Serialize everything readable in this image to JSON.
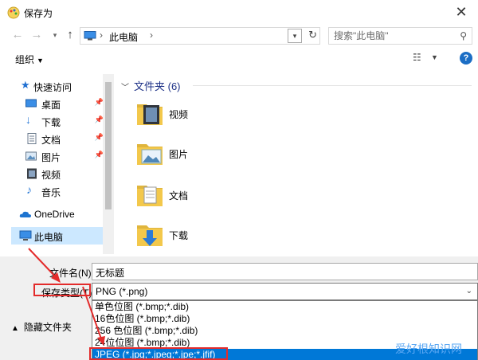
{
  "window": {
    "title": "保存为"
  },
  "address": {
    "crumb": "此电脑"
  },
  "search": {
    "placeholder": "搜索\"此电脑\""
  },
  "toolbar": {
    "organize": "组织"
  },
  "nav": {
    "items": [
      {
        "label": "快速访问",
        "icon": "star-icon",
        "pinned": false
      },
      {
        "label": "桌面",
        "icon": "desktop-icon",
        "pinned": true
      },
      {
        "label": "下载",
        "icon": "download-icon",
        "pinned": true
      },
      {
        "label": "文档",
        "icon": "document-icon",
        "pinned": true
      },
      {
        "label": "图片",
        "icon": "picture-icon",
        "pinned": true
      },
      {
        "label": "视频",
        "icon": "video-icon",
        "pinned": false
      },
      {
        "label": "音乐",
        "icon": "music-icon",
        "pinned": false
      },
      {
        "label": "OneDrive",
        "icon": "cloud-icon",
        "pinned": false
      },
      {
        "label": "此电脑",
        "icon": "computer-icon",
        "pinned": false,
        "selected": true
      }
    ]
  },
  "content": {
    "group_header": "文件夹 (6)",
    "folders": [
      {
        "name": "视频",
        "icon": "video-folder-icon"
      },
      {
        "name": "图片",
        "icon": "pictures-folder-icon"
      },
      {
        "name": "文档",
        "icon": "documents-folder-icon"
      },
      {
        "name": "下载",
        "icon": "downloads-folder-icon"
      }
    ]
  },
  "form": {
    "filename_label": "文件名(N):",
    "filename_value": "无标题",
    "filetype_label": "保存类型(T):",
    "filetype_value": "PNG (*.png)",
    "options": [
      "单色位图 (*.bmp;*.dib)",
      "16色位图 (*.bmp;*.dib)",
      "256 色位图 (*.bmp;*.dib)",
      "24位位图 (*.bmp;*.dib)",
      "JPEG (*.jpg;*.jpeg;*.jpe;*.jfif)"
    ],
    "highlighted_option": 4,
    "hide_folders": "隐藏文件夹"
  },
  "watermark": "爱好根知识网",
  "colors": {
    "accent": "#0078d7",
    "annotation": "#e32b2b",
    "folder": "#f3c84b"
  }
}
